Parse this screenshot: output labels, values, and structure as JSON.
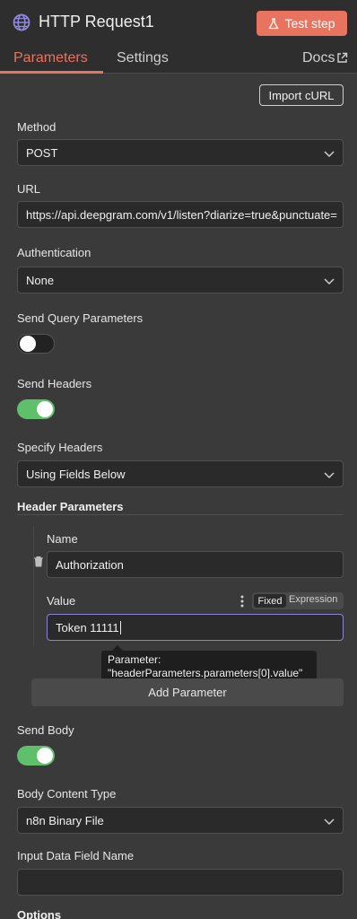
{
  "header": {
    "title": "HTTP Request1",
    "test_step_label": "Test step",
    "icon": "globe-icon"
  },
  "tabs": {
    "parameters": "Parameters",
    "settings": "Settings",
    "docs": "Docs",
    "active": "Parameters"
  },
  "import_curl_label": "Import cURL",
  "method": {
    "label": "Method",
    "value": "POST"
  },
  "url": {
    "label": "URL",
    "value": "https://api.deepgram.com/v1/listen?diarize=true&punctuate="
  },
  "authentication": {
    "label": "Authentication",
    "value": "None"
  },
  "send_query": {
    "label": "Send Query Parameters",
    "enabled": false
  },
  "send_headers": {
    "label": "Send Headers",
    "enabled": true
  },
  "specify_headers": {
    "label": "Specify Headers",
    "value": "Using Fields Below"
  },
  "header_parameters": {
    "title": "Header Parameters",
    "name_label": "Name",
    "name_value": "Authorization",
    "value_label": "Value",
    "value_value": "Token 11111",
    "mode_fixed": "Fixed",
    "mode_expression": "Expression",
    "tooltip_line1": "Parameter:",
    "tooltip_line2": "\"headerParameters.parameters[0].value\"",
    "add_label": "Add Parameter"
  },
  "send_body": {
    "label": "Send Body",
    "enabled": true
  },
  "body_content_type": {
    "label": "Body Content Type",
    "value": "n8n Binary File"
  },
  "input_data_field": {
    "label": "Input Data Field Name",
    "value": ""
  },
  "options_label": "Options",
  "colors": {
    "accent": "#e8735f",
    "toggle_on": "#5fbf6a",
    "focus": "#8a83d6"
  }
}
